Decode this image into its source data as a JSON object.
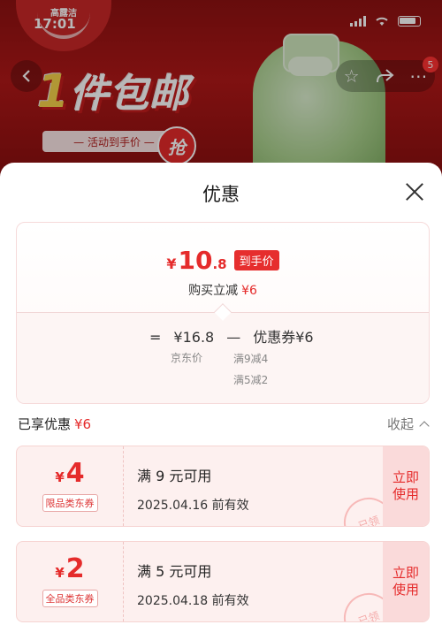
{
  "status": {
    "time": "17:01"
  },
  "banner": {
    "brand": "高露洁",
    "title_num": "1",
    "title_text": "件包邮",
    "subtitle": "— 活动到手价 —",
    "grab": "抢",
    "cart_badge": "5"
  },
  "sheet": {
    "title": "优惠",
    "final": {
      "currency": "¥",
      "integer": "10",
      "decimal": ".8",
      "tag": "到手价"
    },
    "instant": {
      "label": "购买立减",
      "value": "¥6"
    },
    "equation": {
      "eq": "=",
      "jd_price": "¥16.8",
      "minus": "—",
      "coupon_label": "优惠券¥6",
      "jd_label": "京东价",
      "coupon_rules": [
        "满9减4",
        "满5减2"
      ]
    },
    "enjoyed": {
      "label": "已享优惠",
      "value": "¥6"
    },
    "collapse_label": "收起",
    "coupons": [
      {
        "currency": "¥",
        "amount": "4",
        "type": "限品类东券",
        "condition": "满 9 元可用",
        "expiry": "2025.04.16 前有效",
        "stamp": "已领",
        "button": "立即\n使用"
      },
      {
        "currency": "¥",
        "amount": "2",
        "type": "全品类东券",
        "condition": "满 5 元可用",
        "expiry": "2025.04.18 前有效",
        "stamp": "已领",
        "button": "立即\n使用"
      }
    ]
  },
  "colors": {
    "accent": "#e52b2b",
    "banner": "#b01818"
  }
}
